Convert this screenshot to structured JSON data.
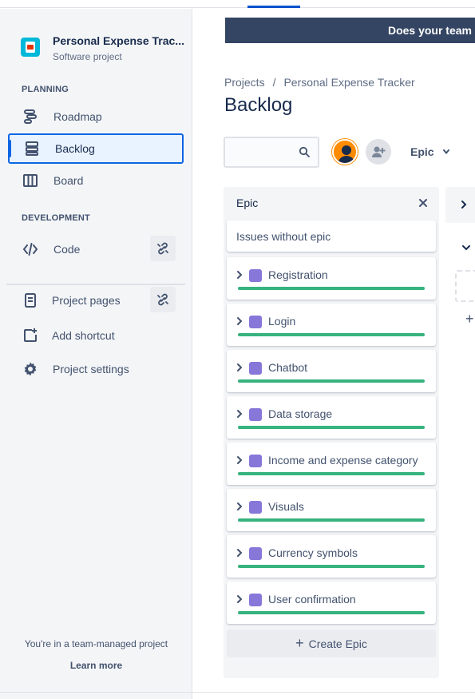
{
  "top_banner": {
    "text": "Does your team"
  },
  "sidebar": {
    "project_name": "Personal Expense Trac...",
    "project_type": "Software project",
    "planning_title": "PLANNING",
    "development_title": "DEVELOPMENT",
    "items": [
      {
        "label": "Roadmap",
        "icon": "roadmap-icon"
      },
      {
        "label": "Backlog",
        "icon": "backlog-icon",
        "active": true
      },
      {
        "label": "Board",
        "icon": "board-icon"
      },
      {
        "label": "Code",
        "icon": "code-icon"
      },
      {
        "label": "Project pages",
        "icon": "page-icon"
      },
      {
        "label": "Add shortcut",
        "icon": "add-shortcut-icon"
      },
      {
        "label": "Project settings",
        "icon": "gear-icon"
      }
    ],
    "footer_note": "You're in a team-managed project",
    "learn_more": "Learn more"
  },
  "breadcrumb": {
    "root": "Projects",
    "separator": "/",
    "project": "Personal Expense Tracker"
  },
  "page_title": "Backlog",
  "toolbar": {
    "search_placeholder": "",
    "epic_filter_label": "Epic"
  },
  "epic_panel": {
    "title": "Epic",
    "issues_without_epic": "Issues without epic",
    "epics": [
      {
        "name": "Registration",
        "progress": 1.0
      },
      {
        "name": "Login",
        "progress": 1.0
      },
      {
        "name": "Chatbot",
        "progress": 1.0
      },
      {
        "name": "Data storage",
        "progress": 1.0
      },
      {
        "name": "Income and expense category",
        "progress": 1.0
      },
      {
        "name": "Visuals",
        "progress": 1.0
      },
      {
        "name": "Currency symbols",
        "progress": 1.0
      },
      {
        "name": "User confirmation",
        "progress": 1.0
      }
    ],
    "create_epic_label": "Create Epic",
    "epic_color": "#8777D9",
    "progress_color": "#36B37E"
  },
  "colors": {
    "accent": "#0C66E4",
    "banner": "#344563",
    "avatar": "#FF8B00"
  }
}
